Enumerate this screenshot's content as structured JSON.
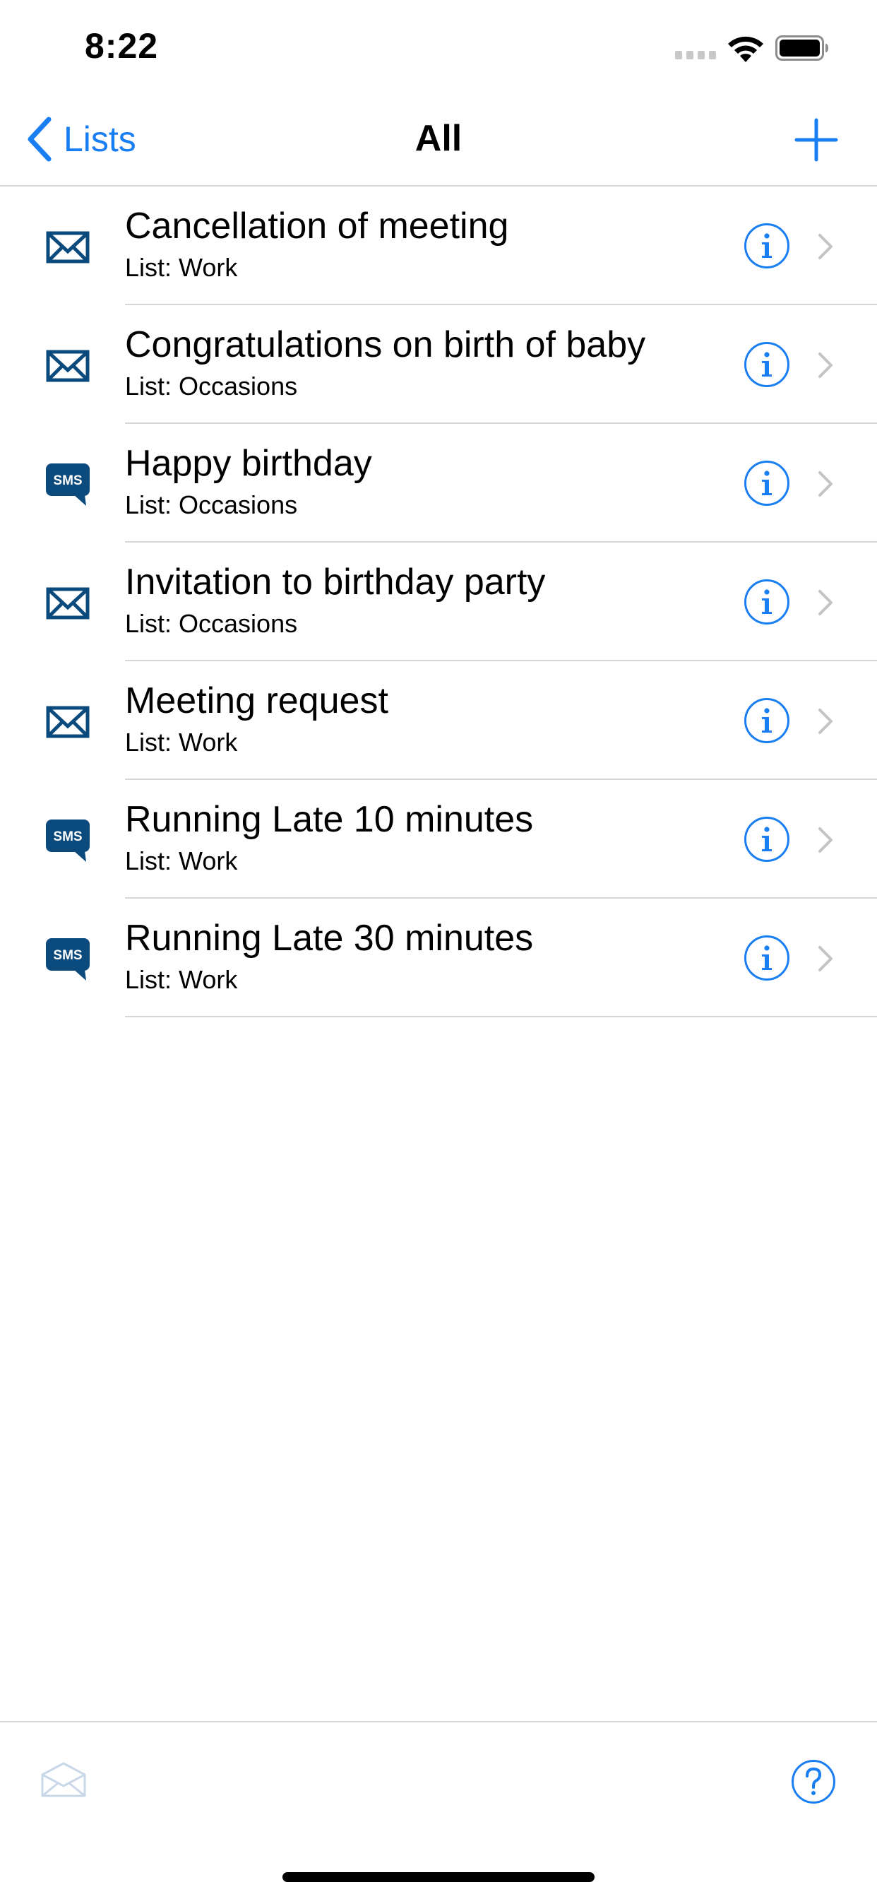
{
  "status_bar": {
    "time": "8:22",
    "signal_icon": "cellular-signal-icon",
    "wifi_icon": "wifi-icon",
    "battery_icon": "battery-icon"
  },
  "nav": {
    "back_label": "Lists",
    "back_icon": "chevron-left-icon",
    "title": "All",
    "add_icon": "plus-icon"
  },
  "items": [
    {
      "type": "email",
      "icon": "envelope-icon",
      "title": "Cancellation of meeting",
      "subtitle": "List: Work"
    },
    {
      "type": "email",
      "icon": "envelope-icon",
      "title": "Congratulations on birth of baby",
      "subtitle": "List: Occasions"
    },
    {
      "type": "sms",
      "icon": "sms-bubble-icon",
      "title": "Happy birthday",
      "subtitle": "List: Occasions"
    },
    {
      "type": "email",
      "icon": "envelope-icon",
      "title": "Invitation to birthday party",
      "subtitle": "List: Occasions"
    },
    {
      "type": "email",
      "icon": "envelope-icon",
      "title": "Meeting request",
      "subtitle": "List: Work"
    },
    {
      "type": "sms",
      "icon": "sms-bubble-icon",
      "title": "Running Late 10 minutes",
      "subtitle": "List: Work"
    },
    {
      "type": "sms",
      "icon": "sms-bubble-icon",
      "title": "Running Late 30 minutes",
      "subtitle": "List: Work"
    }
  ],
  "sms_badge_text": "SMS",
  "toolbar": {
    "compose_icon": "envelope-open-icon",
    "compose_enabled": false,
    "help_icon": "question-mark-icon"
  },
  "colors": {
    "accent": "#1a7ef3",
    "icon_navy": "#0b4a7d",
    "separator": "#d6d6d8",
    "chevron": "#c4c4c7",
    "disabled_icon": "#c9d8e8"
  }
}
